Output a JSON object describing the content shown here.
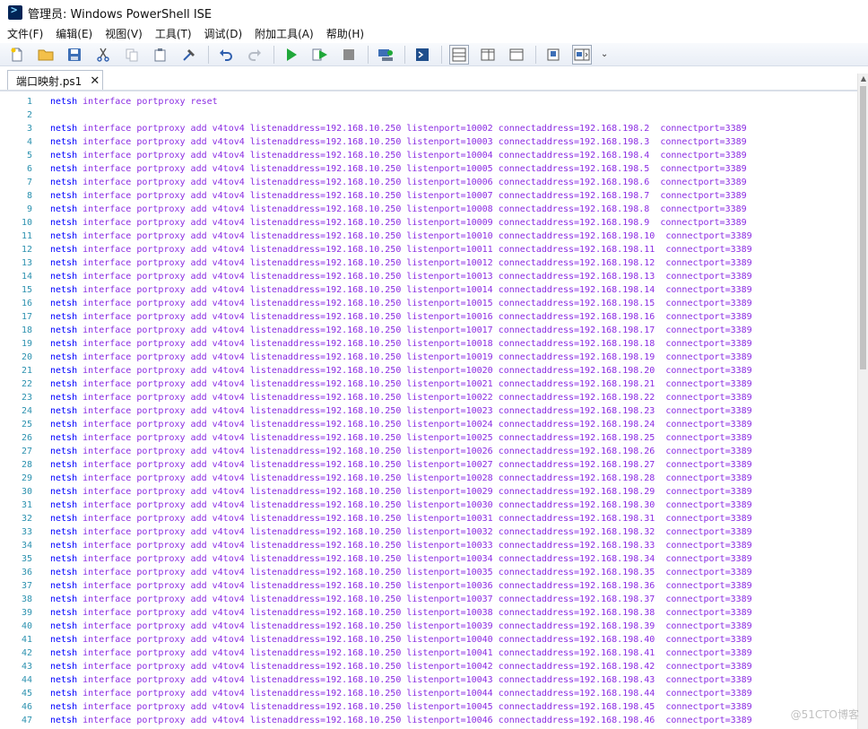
{
  "window": {
    "title": "管理员: Windows PowerShell ISE"
  },
  "menu": {
    "items": [
      "文件(F)",
      "编辑(E)",
      "视图(V)",
      "工具(T)",
      "调试(D)",
      "附加工具(A)",
      "帮助(H)"
    ]
  },
  "toolbar": {
    "overflow_glyph": "⌄"
  },
  "tab": {
    "label": "端口映射.ps1",
    "close_glyph": "✕"
  },
  "editor": {
    "lines": [
      {
        "n": "1",
        "cmd": "netsh",
        "args": "interface portproxy reset"
      },
      {
        "n": "2",
        "cmd": "",
        "args": ""
      },
      {
        "n": "3",
        "cmd": "netsh",
        "args": "interface portproxy add v4tov4 listenaddress=192.168.10.250 listenport=10002 connectaddress=192.168.198.2  connectport=3389"
      },
      {
        "n": "4",
        "cmd": "netsh",
        "args": "interface portproxy add v4tov4 listenaddress=192.168.10.250 listenport=10003 connectaddress=192.168.198.3  connectport=3389"
      },
      {
        "n": "5",
        "cmd": "netsh",
        "args": "interface portproxy add v4tov4 listenaddress=192.168.10.250 listenport=10004 connectaddress=192.168.198.4  connectport=3389"
      },
      {
        "n": "6",
        "cmd": "netsh",
        "args": "interface portproxy add v4tov4 listenaddress=192.168.10.250 listenport=10005 connectaddress=192.168.198.5  connectport=3389"
      },
      {
        "n": "7",
        "cmd": "netsh",
        "args": "interface portproxy add v4tov4 listenaddress=192.168.10.250 listenport=10006 connectaddress=192.168.198.6  connectport=3389"
      },
      {
        "n": "8",
        "cmd": "netsh",
        "args": "interface portproxy add v4tov4 listenaddress=192.168.10.250 listenport=10007 connectaddress=192.168.198.7  connectport=3389"
      },
      {
        "n": "9",
        "cmd": "netsh",
        "args": "interface portproxy add v4tov4 listenaddress=192.168.10.250 listenport=10008 connectaddress=192.168.198.8  connectport=3389"
      },
      {
        "n": "10",
        "cmd": "netsh",
        "args": "interface portproxy add v4tov4 listenaddress=192.168.10.250 listenport=10009 connectaddress=192.168.198.9  connectport=3389"
      },
      {
        "n": "11",
        "cmd": "netsh",
        "args": "interface portproxy add v4tov4 listenaddress=192.168.10.250 listenport=10010 connectaddress=192.168.198.10  connectport=3389"
      },
      {
        "n": "12",
        "cmd": "netsh",
        "args": "interface portproxy add v4tov4 listenaddress=192.168.10.250 listenport=10011 connectaddress=192.168.198.11  connectport=3389"
      },
      {
        "n": "13",
        "cmd": "netsh",
        "args": "interface portproxy add v4tov4 listenaddress=192.168.10.250 listenport=10012 connectaddress=192.168.198.12  connectport=3389"
      },
      {
        "n": "14",
        "cmd": "netsh",
        "args": "interface portproxy add v4tov4 listenaddress=192.168.10.250 listenport=10013 connectaddress=192.168.198.13  connectport=3389"
      },
      {
        "n": "15",
        "cmd": "netsh",
        "args": "interface portproxy add v4tov4 listenaddress=192.168.10.250 listenport=10014 connectaddress=192.168.198.14  connectport=3389"
      },
      {
        "n": "16",
        "cmd": "netsh",
        "args": "interface portproxy add v4tov4 listenaddress=192.168.10.250 listenport=10015 connectaddress=192.168.198.15  connectport=3389"
      },
      {
        "n": "17",
        "cmd": "netsh",
        "args": "interface portproxy add v4tov4 listenaddress=192.168.10.250 listenport=10016 connectaddress=192.168.198.16  connectport=3389"
      },
      {
        "n": "18",
        "cmd": "netsh",
        "args": "interface portproxy add v4tov4 listenaddress=192.168.10.250 listenport=10017 connectaddress=192.168.198.17  connectport=3389"
      },
      {
        "n": "19",
        "cmd": "netsh",
        "args": "interface portproxy add v4tov4 listenaddress=192.168.10.250 listenport=10018 connectaddress=192.168.198.18  connectport=3389"
      },
      {
        "n": "20",
        "cmd": "netsh",
        "args": "interface portproxy add v4tov4 listenaddress=192.168.10.250 listenport=10019 connectaddress=192.168.198.19  connectport=3389"
      },
      {
        "n": "21",
        "cmd": "netsh",
        "args": "interface portproxy add v4tov4 listenaddress=192.168.10.250 listenport=10020 connectaddress=192.168.198.20  connectport=3389"
      },
      {
        "n": "22",
        "cmd": "netsh",
        "args": "interface portproxy add v4tov4 listenaddress=192.168.10.250 listenport=10021 connectaddress=192.168.198.21  connectport=3389"
      },
      {
        "n": "23",
        "cmd": "netsh",
        "args": "interface portproxy add v4tov4 listenaddress=192.168.10.250 listenport=10022 connectaddress=192.168.198.22  connectport=3389"
      },
      {
        "n": "24",
        "cmd": "netsh",
        "args": "interface portproxy add v4tov4 listenaddress=192.168.10.250 listenport=10023 connectaddress=192.168.198.23  connectport=3389"
      },
      {
        "n": "25",
        "cmd": "netsh",
        "args": "interface portproxy add v4tov4 listenaddress=192.168.10.250 listenport=10024 connectaddress=192.168.198.24  connectport=3389"
      },
      {
        "n": "26",
        "cmd": "netsh",
        "args": "interface portproxy add v4tov4 listenaddress=192.168.10.250 listenport=10025 connectaddress=192.168.198.25  connectport=3389"
      },
      {
        "n": "27",
        "cmd": "netsh",
        "args": "interface portproxy add v4tov4 listenaddress=192.168.10.250 listenport=10026 connectaddress=192.168.198.26  connectport=3389"
      },
      {
        "n": "28",
        "cmd": "netsh",
        "args": "interface portproxy add v4tov4 listenaddress=192.168.10.250 listenport=10027 connectaddress=192.168.198.27  connectport=3389"
      },
      {
        "n": "29",
        "cmd": "netsh",
        "args": "interface portproxy add v4tov4 listenaddress=192.168.10.250 listenport=10028 connectaddress=192.168.198.28  connectport=3389"
      },
      {
        "n": "30",
        "cmd": "netsh",
        "args": "interface portproxy add v4tov4 listenaddress=192.168.10.250 listenport=10029 connectaddress=192.168.198.29  connectport=3389"
      },
      {
        "n": "31",
        "cmd": "netsh",
        "args": "interface portproxy add v4tov4 listenaddress=192.168.10.250 listenport=10030 connectaddress=192.168.198.30  connectport=3389"
      },
      {
        "n": "32",
        "cmd": "netsh",
        "args": "interface portproxy add v4tov4 listenaddress=192.168.10.250 listenport=10031 connectaddress=192.168.198.31  connectport=3389"
      },
      {
        "n": "33",
        "cmd": "netsh",
        "args": "interface portproxy add v4tov4 listenaddress=192.168.10.250 listenport=10032 connectaddress=192.168.198.32  connectport=3389"
      },
      {
        "n": "34",
        "cmd": "netsh",
        "args": "interface portproxy add v4tov4 listenaddress=192.168.10.250 listenport=10033 connectaddress=192.168.198.33  connectport=3389"
      },
      {
        "n": "35",
        "cmd": "netsh",
        "args": "interface portproxy add v4tov4 listenaddress=192.168.10.250 listenport=10034 connectaddress=192.168.198.34  connectport=3389"
      },
      {
        "n": "36",
        "cmd": "netsh",
        "args": "interface portproxy add v4tov4 listenaddress=192.168.10.250 listenport=10035 connectaddress=192.168.198.35  connectport=3389"
      },
      {
        "n": "37",
        "cmd": "netsh",
        "args": "interface portproxy add v4tov4 listenaddress=192.168.10.250 listenport=10036 connectaddress=192.168.198.36  connectport=3389"
      },
      {
        "n": "38",
        "cmd": "netsh",
        "args": "interface portproxy add v4tov4 listenaddress=192.168.10.250 listenport=10037 connectaddress=192.168.198.37  connectport=3389"
      },
      {
        "n": "39",
        "cmd": "netsh",
        "args": "interface portproxy add v4tov4 listenaddress=192.168.10.250 listenport=10038 connectaddress=192.168.198.38  connectport=3389"
      },
      {
        "n": "40",
        "cmd": "netsh",
        "args": "interface portproxy add v4tov4 listenaddress=192.168.10.250 listenport=10039 connectaddress=192.168.198.39  connectport=3389"
      },
      {
        "n": "41",
        "cmd": "netsh",
        "args": "interface portproxy add v4tov4 listenaddress=192.168.10.250 listenport=10040 connectaddress=192.168.198.40  connectport=3389"
      },
      {
        "n": "42",
        "cmd": "netsh",
        "args": "interface portproxy add v4tov4 listenaddress=192.168.10.250 listenport=10041 connectaddress=192.168.198.41  connectport=3389"
      },
      {
        "n": "43",
        "cmd": "netsh",
        "args": "interface portproxy add v4tov4 listenaddress=192.168.10.250 listenport=10042 connectaddress=192.168.198.42  connectport=3389"
      },
      {
        "n": "44",
        "cmd": "netsh",
        "args": "interface portproxy add v4tov4 listenaddress=192.168.10.250 listenport=10043 connectaddress=192.168.198.43  connectport=3389"
      },
      {
        "n": "45",
        "cmd": "netsh",
        "args": "interface portproxy add v4tov4 listenaddress=192.168.10.250 listenport=10044 connectaddress=192.168.198.44  connectport=3389"
      },
      {
        "n": "46",
        "cmd": "netsh",
        "args": "interface portproxy add v4tov4 listenaddress=192.168.10.250 listenport=10045 connectaddress=192.168.198.45  connectport=3389"
      },
      {
        "n": "47",
        "cmd": "netsh",
        "args": "interface portproxy add v4tov4 listenaddress=192.168.10.250 listenport=10046 connectaddress=192.168.198.46  connectport=3389"
      }
    ]
  },
  "watermark": "@51CTO博客",
  "colors": {
    "keyword": "#0000ff",
    "argument": "#8a2be2",
    "line_number": "#2b91af"
  }
}
